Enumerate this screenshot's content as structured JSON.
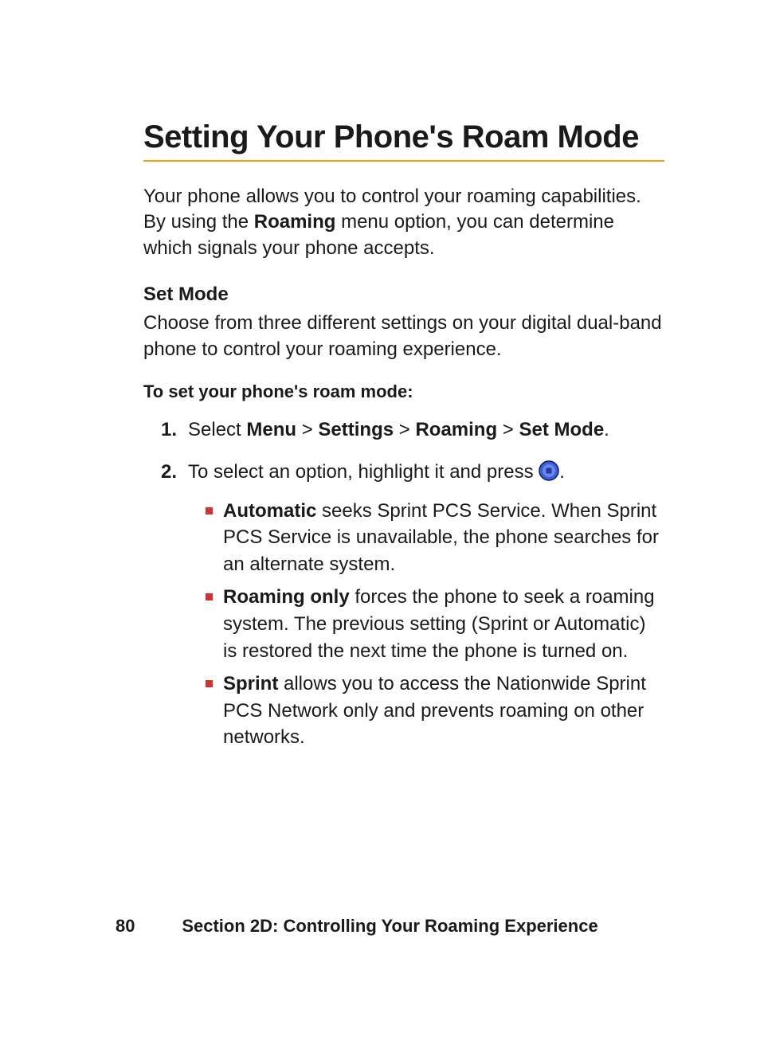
{
  "title": "Setting Your Phone's Roam Mode",
  "intro": {
    "before_bold": "Your phone allows you to control your roaming capabilities. By using the ",
    "bold": "Roaming",
    "after_bold": " menu option, you can determine which signals your phone accepts."
  },
  "set_mode": {
    "heading": "Set Mode",
    "para": "Choose from three different settings on your digital dual-band phone to control your roaming experience."
  },
  "steps": {
    "subhead": "To set your phone's roam mode:",
    "step1": {
      "num": "1.",
      "lead": "Select ",
      "menu": "Menu",
      "sep1": " > ",
      "settings": "Settings",
      "sep2": " > ",
      "roaming": "Roaming",
      "sep3": " > ",
      "setmode": "Set Mode",
      "end": "."
    },
    "step2": {
      "num": "2.",
      "text_before_icon": "To select an option, highlight it and press ",
      "text_after_icon": "."
    },
    "bullets": {
      "auto": {
        "label": "Automatic",
        "text": " seeks Sprint PCS Service. When Sprint PCS Service is unavailable, the phone searches for an alternate system."
      },
      "roaming_only": {
        "label": "Roaming only",
        "text": " forces the phone to seek a roaming system. The previous setting (Sprint or Automatic) is restored the next time the phone is turned on."
      },
      "sprint": {
        "label": "Sprint",
        "text": " allows you to access the Nationwide Sprint PCS Network only and prevents roaming on other networks."
      }
    }
  },
  "footer": {
    "page_number": "80",
    "section": "Section 2D: Controlling Your Roaming Experience"
  },
  "icons": {
    "ok_button": "ok-button-icon"
  }
}
